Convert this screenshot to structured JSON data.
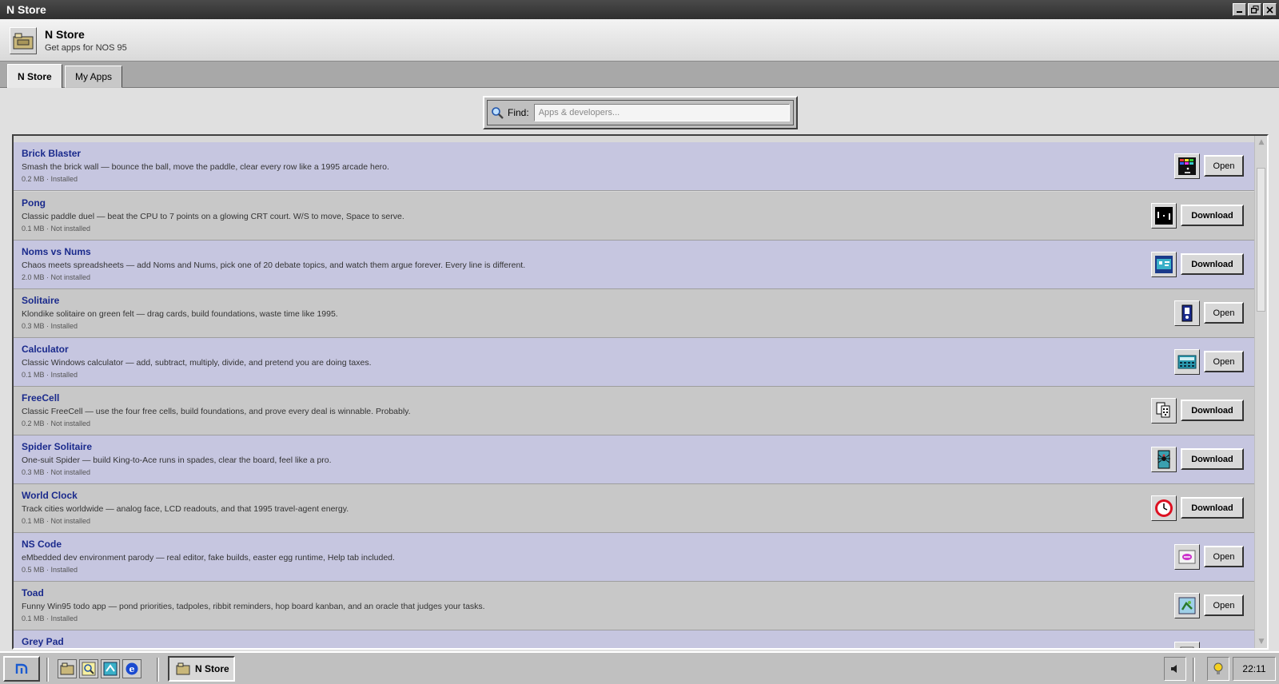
{
  "window": {
    "title": "N Store",
    "controls": [
      "minimize",
      "maximize",
      "close"
    ]
  },
  "header": {
    "app_name": "N Store",
    "subtitle": "Get apps for NOS 95"
  },
  "tabs": [
    {
      "label": "N Store",
      "active": true
    },
    {
      "label": "My Apps",
      "active": false
    }
  ],
  "search": {
    "label": "Find:",
    "placeholder": "Apps & developers..."
  },
  "apps": [
    {
      "name": "Brick Blaster",
      "description": "Smash the brick wall — bounce the ball, move the paddle, clear every row like a 1995 arcade hero.",
      "meta": "0.2 MB · Installed",
      "action": "Open",
      "icon": "brick-icon"
    },
    {
      "name": "Pong",
      "description": "Classic paddle duel — beat the CPU to 7 points on a glowing CRT court. W/S to move, Space to serve.",
      "meta": "0.1 MB · Not installed",
      "action": "Download",
      "icon": "pong-icon"
    },
    {
      "name": "Noms vs Nums",
      "description": "Chaos meets spreadsheets — add Noms and Nums, pick one of 20 debate topics, and watch them argue forever. Every line is different.",
      "meta": "2.0 MB · Not installed",
      "action": "Download",
      "icon": "noms-icon"
    },
    {
      "name": "Solitaire",
      "description": "Klondike solitaire on green felt — drag cards, build foundations, waste time like 1995.",
      "meta": "0.3 MB · Installed",
      "action": "Open",
      "icon": "cards-icon"
    },
    {
      "name": "Calculator",
      "description": "Classic Windows calculator — add, subtract, multiply, divide, and pretend you are doing taxes.",
      "meta": "0.1 MB · Installed",
      "action": "Open",
      "icon": "calculator-icon"
    },
    {
      "name": "FreeCell",
      "description": "Classic FreeCell — use the four free cells, build foundations, and prove every deal is winnable. Probably.",
      "meta": "0.2 MB · Not installed",
      "action": "Download",
      "icon": "freecell-icon"
    },
    {
      "name": "Spider Solitaire",
      "description": "One-suit Spider — build King-to-Ace runs in spades, clear the board, feel like a pro.",
      "meta": "0.3 MB · Not installed",
      "action": "Download",
      "icon": "spider-icon"
    },
    {
      "name": "World Clock",
      "description": "Track cities worldwide — analog face, LCD readouts, and that 1995 travel-agent energy.",
      "meta": "0.1 MB · Not installed",
      "action": "Download",
      "icon": "clock-icon"
    },
    {
      "name": "NS Code",
      "description": "eMbedded dev environment parody — real editor, fake builds, easter egg runtime, Help tab included.",
      "meta": "0.5 MB · Installed",
      "action": "Open",
      "icon": "code-icon"
    },
    {
      "name": "Toad",
      "description": "Funny Win95 todo app — pond priorities, tadpoles, ribbit reminders, hop board kanban, and an oracle that judges your tasks.",
      "meta": "0.1 MB · Installed",
      "action": "Open",
      "icon": "toad-icon"
    },
    {
      "name": "Grey Pad",
      "description": "",
      "meta": "",
      "action": "",
      "icon": "notepad-icon"
    }
  ],
  "taskbar": {
    "task_label": "N Store",
    "clock": "22:11"
  },
  "colors": {
    "row_odd": "#c6c6e0",
    "row_even": "#c8c8c8",
    "app_name": "#1a2a8c",
    "titlebar": "#3a3a3a"
  }
}
